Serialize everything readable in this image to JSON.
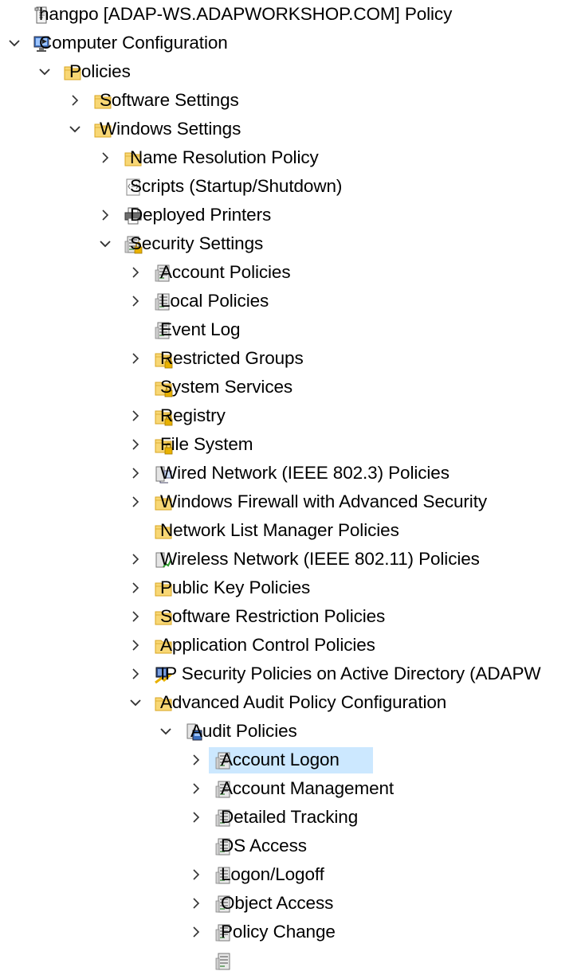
{
  "tree": [
    {
      "label": "hangpo [ADAP-WS.ADAPWORKSHOP.COM] Policy",
      "level": 0,
      "chevron": "none",
      "icon": "policy-scroll",
      "name": "tree-item-root-policy"
    },
    {
      "label": "Computer Configuration",
      "level": 0,
      "chevron": "expanded",
      "icon": "computer",
      "name": "tree-item-computer-configuration"
    },
    {
      "label": "Policies",
      "level": 1,
      "chevron": "expanded",
      "icon": "folder",
      "name": "tree-item-policies"
    },
    {
      "label": "Software Settings",
      "level": 2,
      "chevron": "collapsed",
      "icon": "folder",
      "name": "tree-item-software-settings"
    },
    {
      "label": "Windows Settings",
      "level": 2,
      "chevron": "expanded",
      "icon": "folder",
      "name": "tree-item-windows-settings"
    },
    {
      "label": "Name Resolution Policy",
      "level": 3,
      "chevron": "collapsed",
      "icon": "folder",
      "name": "tree-item-name-resolution-policy"
    },
    {
      "label": "Scripts (Startup/Shutdown)",
      "level": 3,
      "chevron": "none",
      "icon": "script",
      "name": "tree-item-scripts"
    },
    {
      "label": "Deployed Printers",
      "level": 3,
      "chevron": "collapsed",
      "icon": "printer",
      "name": "tree-item-deployed-printers"
    },
    {
      "label": "Security Settings",
      "level": 3,
      "chevron": "expanded",
      "icon": "security",
      "name": "tree-item-security-settings"
    },
    {
      "label": "Account Policies",
      "level": 4,
      "chevron": "collapsed",
      "icon": "server",
      "name": "tree-item-account-policies"
    },
    {
      "label": "Local Policies",
      "level": 4,
      "chevron": "collapsed",
      "icon": "server",
      "name": "tree-item-local-policies"
    },
    {
      "label": "Event Log",
      "level": 4,
      "chevron": "none",
      "icon": "server",
      "name": "tree-item-event-log"
    },
    {
      "label": "Restricted Groups",
      "level": 4,
      "chevron": "collapsed",
      "icon": "folder-lock",
      "name": "tree-item-restricted-groups"
    },
    {
      "label": "System Services",
      "level": 4,
      "chevron": "none",
      "icon": "folder-lock",
      "name": "tree-item-system-services"
    },
    {
      "label": "Registry",
      "level": 4,
      "chevron": "collapsed",
      "icon": "folder-lock",
      "name": "tree-item-registry"
    },
    {
      "label": "File System",
      "level": 4,
      "chevron": "collapsed",
      "icon": "folder-lock",
      "name": "tree-item-file-system"
    },
    {
      "label": "Wired Network (IEEE 802.3) Policies",
      "level": 4,
      "chevron": "collapsed",
      "icon": "wired-network",
      "name": "tree-item-wired-network"
    },
    {
      "label": "Windows Firewall with Advanced Security",
      "level": 4,
      "chevron": "collapsed",
      "icon": "folder",
      "name": "tree-item-windows-firewall"
    },
    {
      "label": "Network List Manager Policies",
      "level": 4,
      "chevron": "none",
      "icon": "folder",
      "name": "tree-item-network-list-manager"
    },
    {
      "label": "Wireless Network (IEEE 802.11) Policies",
      "level": 4,
      "chevron": "collapsed",
      "icon": "wireless-network",
      "name": "tree-item-wireless-network"
    },
    {
      "label": "Public Key Policies",
      "level": 4,
      "chevron": "collapsed",
      "icon": "folder",
      "name": "tree-item-public-key-policies"
    },
    {
      "label": "Software Restriction Policies",
      "level": 4,
      "chevron": "collapsed",
      "icon": "folder",
      "name": "tree-item-software-restriction"
    },
    {
      "label": "Application Control Policies",
      "level": 4,
      "chevron": "collapsed",
      "icon": "folder",
      "name": "tree-item-application-control"
    },
    {
      "label": "IP Security Policies on Active Directory (ADAPW",
      "level": 4,
      "chevron": "collapsed",
      "icon": "ip-security",
      "name": "tree-item-ip-security"
    },
    {
      "label": "Advanced Audit Policy Configuration",
      "level": 4,
      "chevron": "expanded",
      "icon": "folder",
      "name": "tree-item-advanced-audit"
    },
    {
      "label": "Audit Policies",
      "level": 5,
      "chevron": "expanded",
      "icon": "audit",
      "name": "tree-item-audit-policies"
    },
    {
      "label": "Account Logon",
      "level": 6,
      "chevron": "collapsed",
      "icon": "server",
      "selected": true,
      "name": "tree-item-account-logon"
    },
    {
      "label": "Account Management",
      "level": 6,
      "chevron": "collapsed",
      "icon": "server",
      "name": "tree-item-account-management"
    },
    {
      "label": "Detailed Tracking",
      "level": 6,
      "chevron": "collapsed",
      "icon": "server",
      "name": "tree-item-detailed-tracking"
    },
    {
      "label": "DS Access",
      "level": 6,
      "chevron": "none",
      "icon": "server",
      "name": "tree-item-ds-access"
    },
    {
      "label": "Logon/Logoff",
      "level": 6,
      "chevron": "collapsed",
      "icon": "server",
      "name": "tree-item-logon-logoff"
    },
    {
      "label": "Object Access",
      "level": 6,
      "chevron": "collapsed",
      "icon": "server",
      "name": "tree-item-object-access"
    },
    {
      "label": "Policy Change",
      "level": 6,
      "chevron": "collapsed",
      "icon": "server",
      "name": "tree-item-policy-change"
    },
    {
      "label": "",
      "level": 6,
      "chevron": "none",
      "icon": "server",
      "name": "tree-item-partial"
    }
  ],
  "colors": {
    "selection": "#cce8ff",
    "folder": "#f8d775",
    "folder_edge": "#d9a620",
    "chevron": "#333333",
    "lock": "#e8b100"
  }
}
